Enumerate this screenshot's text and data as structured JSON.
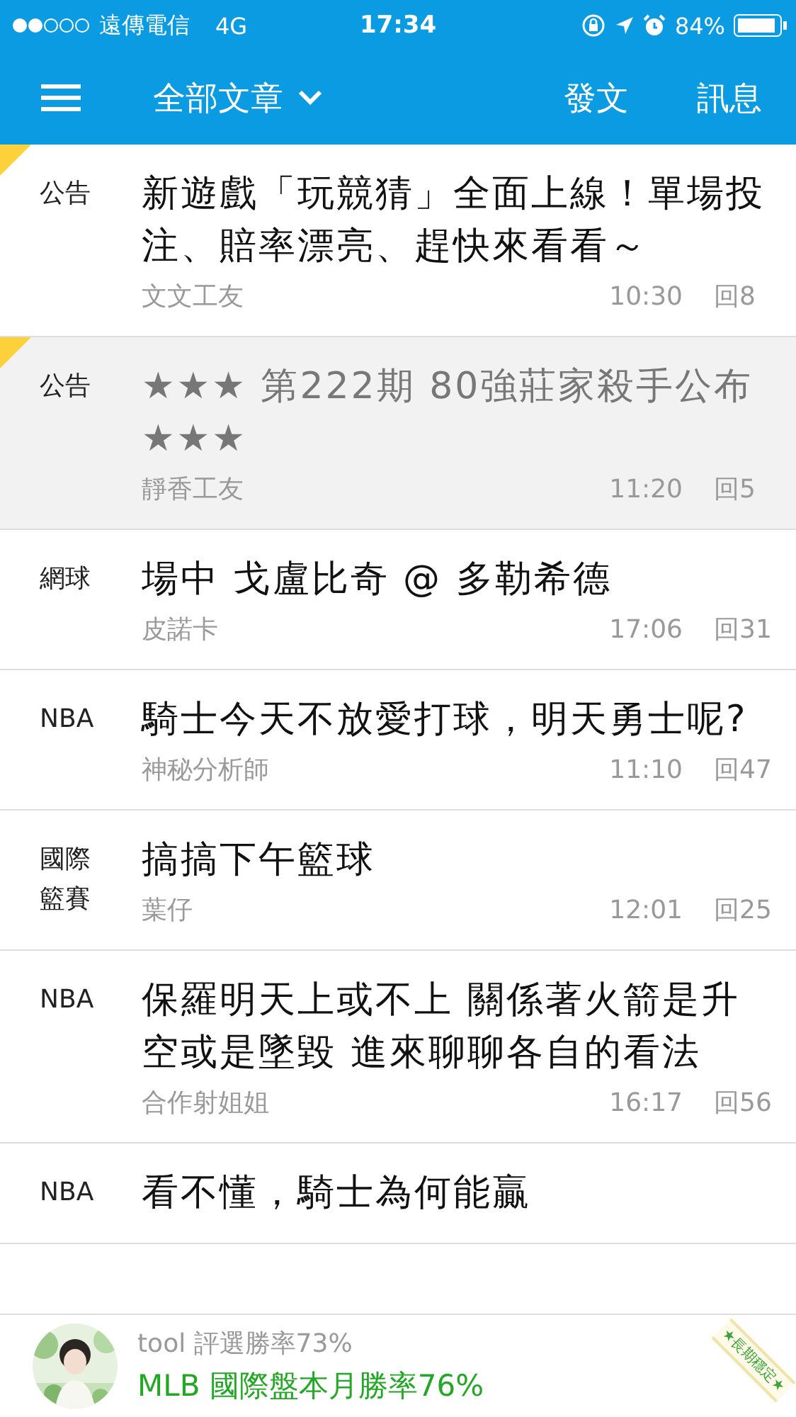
{
  "status_bar": {
    "carrier": "遠傳電信",
    "network": "4G",
    "time": "17:34",
    "battery": "84%"
  },
  "nav_bar": {
    "title": "全部文章",
    "actions": [
      "發文",
      "訊息"
    ]
  },
  "posts": [
    {
      "category": "公告",
      "title": "新遊戲「玩競猜」全面上線！單場投注、賠率漂亮、趕快來看看～",
      "author": "文文工友",
      "time": "10:30",
      "replies": "回8",
      "pinned": true,
      "read": false
    },
    {
      "category": "公告",
      "title": "★★★ 第222期 80強莊家殺手公布★★★",
      "author": "靜香工友",
      "time": "11:20",
      "replies": "回5",
      "pinned": true,
      "read": true
    },
    {
      "category": "網球",
      "title": "場中 戈盧比奇 @ 多勒希德",
      "author": "皮諾卡",
      "time": "17:06",
      "replies": "回31",
      "pinned": false,
      "read": false
    },
    {
      "category": "NBA",
      "title": "騎士今天不放愛打球，明天勇士呢?",
      "author": "神秘分析師",
      "time": "11:10",
      "replies": "回47",
      "pinned": false,
      "read": false
    },
    {
      "category": "國際籃賽",
      "title": "搞搞下午籃球",
      "author": "葉仔",
      "time": "12:01",
      "replies": "回25",
      "pinned": false,
      "read": false
    },
    {
      "category": "NBA",
      "title": "保羅明天上或不上 關係著火箭是升空或是墜毀 進來聊聊各自的看法",
      "author": "合作射姐姐",
      "time": "16:17",
      "replies": "回56",
      "pinned": false,
      "read": false
    },
    {
      "category": "NBA",
      "title": "看不懂，騎士為何能贏"
    }
  ],
  "banner": {
    "subtitle": "tool 評選勝率73%",
    "headline": "MLB 國際盤本月勝率76%",
    "ribbon": "★長期穩定★"
  }
}
